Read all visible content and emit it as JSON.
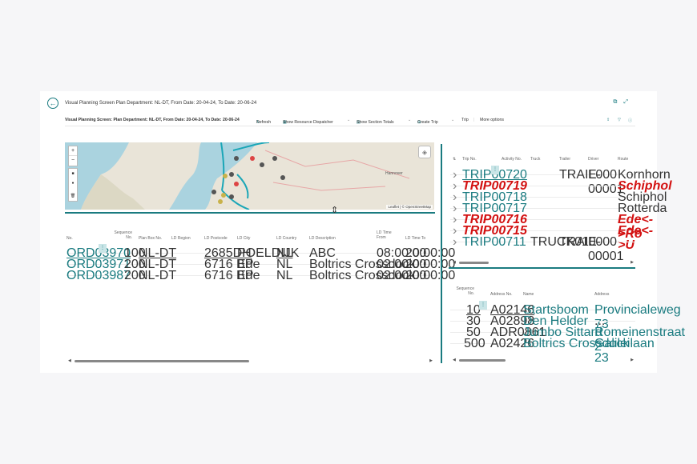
{
  "window": {
    "title": "Visual Planning Screen Plan Department: NL-DT, From Date: 20-04-24, To Date: 20-06-24",
    "back_glyph": "←",
    "share_glyph": "⧉",
    "expand_glyph": "⤢"
  },
  "actionbar": {
    "title": "Visual Planning Screen: Plan Department: NL-DT, From Date: 20-04-24, To Date: 20-06-24",
    "refresh": "Refresh",
    "show_resource_dispatcher": "Show Resource Dispatcher",
    "show_section_totals": "Show Section Totals",
    "create_trip": "Create Trip",
    "trip": "Trip",
    "more_options": "More options"
  },
  "map": {
    "zoom_in": "+",
    "zoom_out": "−",
    "attribution": "Leaflet | © OpenStreetMap",
    "city_label": "Hannover"
  },
  "orders": {
    "headers": [
      "No.",
      "Sequence No.",
      "Plan Box No.",
      "LD Region",
      "LD Postcode",
      "LD City",
      "LD Country",
      "LD Description",
      "LD Time From",
      "LD Time To"
    ],
    "rows": [
      {
        "no": "ORD03970",
        "seq": "100",
        "plan_box": "NL-DT",
        "region": "",
        "postcode": "2685DH",
        "city": "POELDIJK",
        "country": "NL",
        "desc": "ABC",
        "from": "08:00:00",
        "to": "20:00:00"
      },
      {
        "no": "ORD03971",
        "seq": "200",
        "plan_box": "NL-DT",
        "region": "",
        "postcode": "6716 BP",
        "city": "Ede",
        "country": "NL",
        "desc": "Boltrics Crossdock",
        "from": "02:00:00",
        "to": "20:00:00"
      },
      {
        "no": "ORD03987",
        "seq": "200",
        "plan_box": "NL-DT",
        "region": "",
        "postcode": "6716 BP",
        "city": "Ede",
        "country": "NL",
        "desc": "Boltrics Crossdock",
        "from": "02:00:00",
        "to": "20:00:00"
      }
    ]
  },
  "trips": {
    "headers": [
      "Trip No.",
      "Activity No.",
      "Truck",
      "Trailer",
      "Driver",
      "Route"
    ],
    "rows": [
      {
        "no": "TRIP00720",
        "activity": "",
        "truck": "",
        "trailer": "TRAIL000",
        "driver": "E-00001",
        "route": "Kornhorn",
        "style": "link"
      },
      {
        "no": "TRIP00719",
        "activity": "",
        "truck": "",
        "trailer": "",
        "driver": "",
        "route": "Schiphol",
        "style": "red"
      },
      {
        "no": "TRIP00718",
        "activity": "",
        "truck": "",
        "trailer": "",
        "driver": "",
        "route": "Schiphol",
        "style": "link"
      },
      {
        "no": "TRIP00717",
        "activity": "",
        "truck": "",
        "trailer": "",
        "driver": "",
        "route": "Rotterda",
        "style": "link"
      },
      {
        "no": "TRIP00716",
        "activity": "",
        "truck": "",
        "trailer": "",
        "driver": "",
        "route": "Ede<->Ro",
        "style": "red"
      },
      {
        "no": "TRIP00715",
        "activity": "",
        "truck": "",
        "trailer": "",
        "driver": "",
        "route": "Ede<->U",
        "style": "red"
      },
      {
        "no": "TRIP00711",
        "activity": "",
        "truck": "TRUCK010",
        "trailer": "TRAIL000",
        "driver": "E-00001",
        "route": "",
        "style": "link"
      }
    ]
  },
  "stops": {
    "headers": [
      "Sequence No.",
      "Address No.",
      "Name",
      "Address"
    ],
    "rows": [
      {
        "seq": "10",
        "addr_no": "A02146",
        "name": "Startsboom",
        "address": "Provincialeweg 73"
      },
      {
        "seq": "30",
        "addr_no": "A02898",
        "name": "Den Helder",
        "address": "..."
      },
      {
        "seq": "50",
        "addr_no": "ADR0861",
        "name": "Jumbo Sittard",
        "address": "Romeinenstraat 2"
      },
      {
        "seq": "500",
        "addr_no": "A02426",
        "name": "Boltrics Crossdock",
        "address": "Galileilaan 23"
      }
    ]
  },
  "colors": {
    "accent": "#1a7b80",
    "alert": "#d31212"
  }
}
